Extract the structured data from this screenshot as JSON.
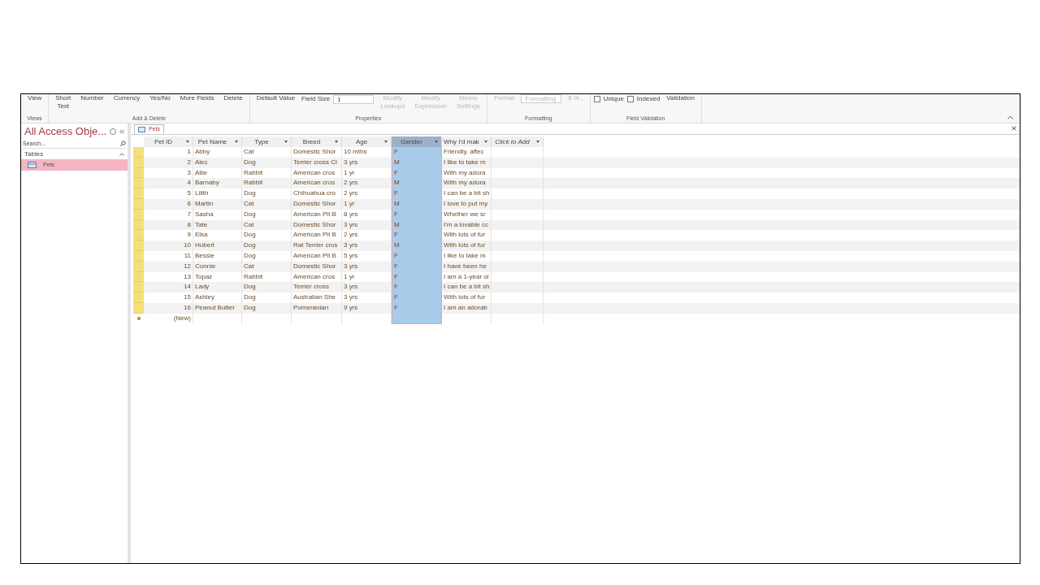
{
  "ribbon": {
    "groups": [
      {
        "label": "Views",
        "items": [
          {
            "kind": "button",
            "label": "View",
            "disabled": false
          }
        ]
      },
      {
        "label": "Add & Delete",
        "items": [
          {
            "kind": "button",
            "label": "Short Text",
            "disabled": false
          },
          {
            "kind": "button",
            "label": "Number",
            "disabled": false
          },
          {
            "kind": "button",
            "label": "Currency",
            "disabled": false
          },
          {
            "kind": "small",
            "label": "Yes/No",
            "disabled": false
          },
          {
            "kind": "small",
            "label": "More Fields",
            "disabled": false
          },
          {
            "kind": "button",
            "label": "Delete",
            "disabled": false
          }
        ]
      },
      {
        "label": "Properties",
        "items": [
          {
            "kind": "small",
            "label": "Default Value",
            "disabled": false
          },
          {
            "kind": "field",
            "label": "Field Size",
            "value": "1",
            "disabled": false
          },
          {
            "kind": "button",
            "label": "Modify Lookups",
            "disabled": true
          },
          {
            "kind": "button",
            "label": "Modify Expression",
            "disabled": true
          },
          {
            "kind": "button",
            "label": "Memo Settings",
            "disabled": true
          }
        ]
      },
      {
        "label": "Formatting",
        "items": [
          {
            "kind": "small",
            "label": "Format",
            "disabled": true
          },
          {
            "kind": "field",
            "value": "Formatting",
            "disabled": true
          },
          {
            "kind": "small",
            "label": "$ % ,",
            "disabled": true
          }
        ]
      },
      {
        "label": "Field Validation",
        "items": [
          {
            "kind": "check",
            "label": "Unique",
            "checked": false
          },
          {
            "kind": "check",
            "label": "Indexed",
            "checked": false
          },
          {
            "kind": "button",
            "label": "Validation",
            "disabled": false
          }
        ]
      }
    ]
  },
  "nav": {
    "title": "All Access Obje...",
    "search": {
      "placeholder": "Search..."
    },
    "section": "Tables",
    "items": [
      {
        "label": "Pets",
        "selected": true
      }
    ]
  },
  "tab": {
    "label": "Pets"
  },
  "table": {
    "columns": [
      {
        "label": "Pet ID",
        "selected": false,
        "kind": "number"
      },
      {
        "label": "Pet Name",
        "selected": false,
        "kind": "text"
      },
      {
        "label": "Type",
        "selected": false,
        "kind": "text"
      },
      {
        "label": "Breed",
        "selected": false,
        "kind": "text"
      },
      {
        "label": "Age",
        "selected": false,
        "kind": "text"
      },
      {
        "label": "Gender",
        "selected": true,
        "kind": "text"
      },
      {
        "label": "Why I'd mak",
        "selected": false,
        "kind": "text"
      },
      {
        "label": "Click to Add",
        "selected": false,
        "kind": "add"
      }
    ],
    "rows": [
      [
        "1",
        "Abby",
        "Cat",
        "Domestic Shor",
        "10 mths",
        "F",
        "Friendly, affec"
      ],
      [
        "2",
        "Alec",
        "Dog",
        "Terrier cross Cl",
        "3 yrs",
        "M",
        "I like to take m"
      ],
      [
        "3",
        "Allie",
        "Rabbit",
        "American cros",
        "1 yr",
        "F",
        "With my adora"
      ],
      [
        "4",
        "Barnaby",
        "Rabbit",
        "American cros",
        "2 yrs",
        "M",
        "With my adora"
      ],
      [
        "5",
        "Lilith",
        "Dog",
        "Chihuahua cro",
        "2 yrs",
        "F",
        "I can be a bit sh"
      ],
      [
        "6",
        "Martin",
        "Cat",
        "Domestic Shor",
        "1 yr",
        "M",
        "I love to put my"
      ],
      [
        "7",
        "Sasha",
        "Dog",
        "American Pit B",
        "8 yrs",
        "F",
        "Whether we sr"
      ],
      [
        "8",
        "Tate",
        "Cat",
        "Domestic Shor",
        "3 yrs",
        "M",
        "I'm a lovable cc"
      ],
      [
        "9",
        "Elsa",
        "Dog",
        "American Pit B",
        "2 yrs",
        "F",
        "With lots of fur"
      ],
      [
        "10",
        "Hubert",
        "Dog",
        "Rat Terrier cros",
        "3 yrs",
        "M",
        "With lots of fur"
      ],
      [
        "11",
        "Bessie",
        "Dog",
        "American Pit B",
        "5 yrs",
        "F",
        "I like to take m"
      ],
      [
        "12",
        "Connie",
        "Cat",
        "Domestic Shor",
        "3 yrs",
        "F",
        "I have been he"
      ],
      [
        "13",
        "Topaz",
        "Rabbit",
        "American cros",
        "1 yr",
        "F",
        "I am a 1-year ol"
      ],
      [
        "14",
        "Lady",
        "Dog",
        "Terrier cross",
        "3 yrs",
        "F",
        "I can be a bit sh"
      ],
      [
        "15",
        "Ashley",
        "Dog",
        "Australian She",
        "3 yrs",
        "F",
        "With lots of fur"
      ],
      [
        "16",
        "Peanut Butter",
        "Dog",
        "Pomeranian",
        "9 yrs",
        "F",
        "I am an adorab"
      ]
    ],
    "new_row": "(New)"
  }
}
